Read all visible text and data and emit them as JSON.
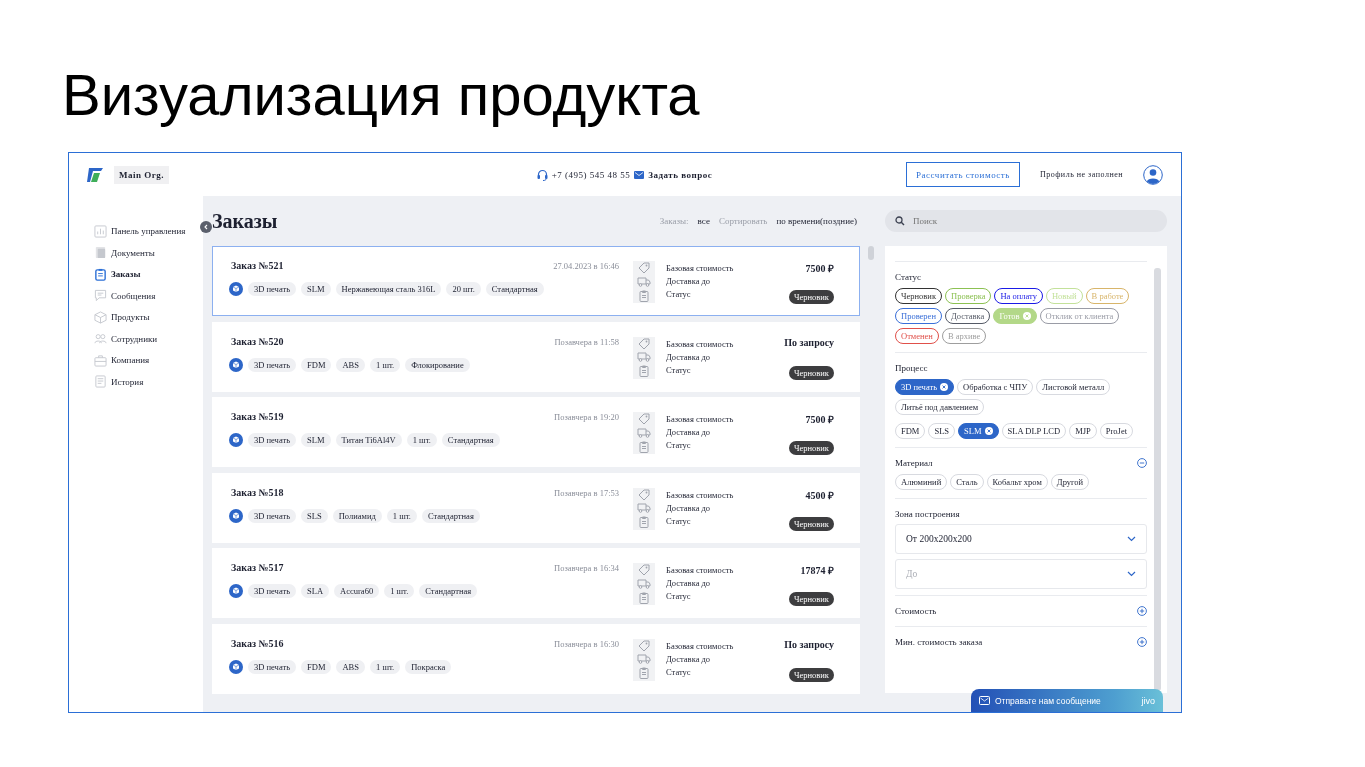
{
  "slide_title": "Визуализация продукта",
  "header": {
    "org": "Main Org.",
    "phone": "+7 (495) 545 48 55",
    "ask": "Задать вопрос",
    "calc_button": "Рассчитать стоимость",
    "profile": "Профиль не заполнен"
  },
  "sidebar": {
    "items": [
      {
        "label": "Панель управления",
        "selected": false
      },
      {
        "label": "Документы",
        "selected": false
      },
      {
        "label": "Заказы",
        "selected": true
      },
      {
        "label": "Сообщения",
        "selected": false
      },
      {
        "label": "Продукты",
        "selected": false
      },
      {
        "label": "Сотрудники",
        "selected": false
      },
      {
        "label": "Компания",
        "selected": false
      },
      {
        "label": "История",
        "selected": false
      }
    ]
  },
  "toolbar": {
    "title": "Заказы",
    "filter_label": "Заказы:",
    "filter_value": "все",
    "sort_label": "Сортировать",
    "sort_value": "по времени(поздние)",
    "search": {
      "placeholder": "Поиск"
    }
  },
  "orders": [
    {
      "title": "Заказ №521",
      "date": "27.04.2023 в 16:46",
      "tags": [
        "3D печать",
        "SLM",
        "Нержавеющая сталь 316L",
        "20 шт.",
        "Стандартная"
      ],
      "base_label": "Базовая стоимость",
      "delivery_label": "Доставка до",
      "status_label": "Статус",
      "price": "7500 ₽",
      "status": "Черновик",
      "selected": true
    },
    {
      "title": "Заказ №520",
      "date": "Позавчера в 11:58",
      "tags": [
        "3D печать",
        "FDM",
        "ABS",
        "1 шт.",
        "Флокирование"
      ],
      "base_label": "Базовая стоимость",
      "delivery_label": "Доставка до",
      "status_label": "Статус",
      "price": "По запросу",
      "status": "Черновик",
      "selected": false
    },
    {
      "title": "Заказ №519",
      "date": "Позавчера в 19:20",
      "tags": [
        "3D печать",
        "SLM",
        "Титан Ti6Al4V",
        "1 шт.",
        "Стандартная"
      ],
      "base_label": "Базовая стоимость",
      "delivery_label": "Доставка до",
      "status_label": "Статус",
      "price": "7500 ₽",
      "status": "Черновик",
      "selected": false
    },
    {
      "title": "Заказ №518",
      "date": "Позавчера в 17:53",
      "tags": [
        "3D печать",
        "SLS",
        "Полиамид",
        "1 шт.",
        "Стандартная"
      ],
      "base_label": "Базовая стоимость",
      "delivery_label": "Доставка до",
      "status_label": "Статус",
      "price": "4500 ₽",
      "status": "Черновик",
      "selected": false
    },
    {
      "title": "Заказ №517",
      "date": "Позавчера в 16:34",
      "tags": [
        "3D печать",
        "SLA",
        "Accura60",
        "1 шт.",
        "Стандартная"
      ],
      "base_label": "Базовая стоимость",
      "delivery_label": "Доставка до",
      "status_label": "Статус",
      "price": "17874 ₽",
      "status": "Черновик",
      "selected": false
    },
    {
      "title": "Заказ №516",
      "date": "Позавчера в 16:30",
      "tags": [
        "3D печать",
        "FDM",
        "ABS",
        "1 шт.",
        "Покраска"
      ],
      "base_label": "Базовая стоимость",
      "delivery_label": "Доставка до",
      "status_label": "Статус",
      "price": "По запросу",
      "status": "Черновик",
      "selected": false
    }
  ],
  "filters": {
    "status": {
      "title": "Статус",
      "chips": [
        {
          "label": "Черновик",
          "color": "#333333",
          "selected": false
        },
        {
          "label": "Проверка",
          "color": "#8cc152",
          "selected": false
        },
        {
          "label": "На оплату",
          "color": "#1a1ae6",
          "selected": false
        },
        {
          "label": "Новый",
          "color": "#c3e19a",
          "selected": false
        },
        {
          "label": "В работе",
          "color": "#d8b56a",
          "selected": false
        },
        {
          "label": "Проверен",
          "color": "#3a6fd8",
          "selected": false
        },
        {
          "label": "Доставка",
          "color": "#555a66",
          "selected": false
        },
        {
          "label": "Готов",
          "color": "#b3d888",
          "selected": true
        },
        {
          "label": "Отклик от клиента",
          "color": "#9a9ca6",
          "selected": false
        },
        {
          "label": "Отменен",
          "color": "#e0504a",
          "selected": false
        },
        {
          "label": "В архиве",
          "color": "#9e9e9e",
          "selected": false
        }
      ]
    },
    "process": {
      "title": "Процесс",
      "chips": [
        {
          "label": "3D печать",
          "selected": true
        },
        {
          "label": "Обработка с ЧПУ",
          "selected": false
        },
        {
          "label": "Листовой металл",
          "selected": false
        },
        {
          "label": "Литьё под давлением",
          "selected": false
        }
      ],
      "tech_chips": [
        {
          "label": "FDM",
          "selected": false
        },
        {
          "label": "SLS",
          "selected": false
        },
        {
          "label": "SLM",
          "selected": true
        },
        {
          "label": "SLA DLP LCD",
          "selected": false
        },
        {
          "label": "MJP",
          "selected": false
        },
        {
          "label": "ProJet",
          "selected": false
        }
      ]
    },
    "material": {
      "title": "Материал",
      "expanded": true,
      "chips": [
        {
          "label": "Алюминий",
          "selected": false
        },
        {
          "label": "Сталь",
          "selected": false
        },
        {
          "label": "Кобальт хром",
          "selected": false
        },
        {
          "label": "Другой",
          "selected": false
        }
      ]
    },
    "zone": {
      "title": "Зона построения",
      "from_value": "От 200x200x200",
      "to": {
        "placeholder": "До"
      }
    },
    "collapsed": [
      {
        "title": "Стоимость",
        "expanded": false
      },
      {
        "title": "Мин. стоимость заказа",
        "expanded": false
      }
    ]
  },
  "chat": {
    "label": "Отправьте нам сообщение",
    "logo": "jivo"
  }
}
